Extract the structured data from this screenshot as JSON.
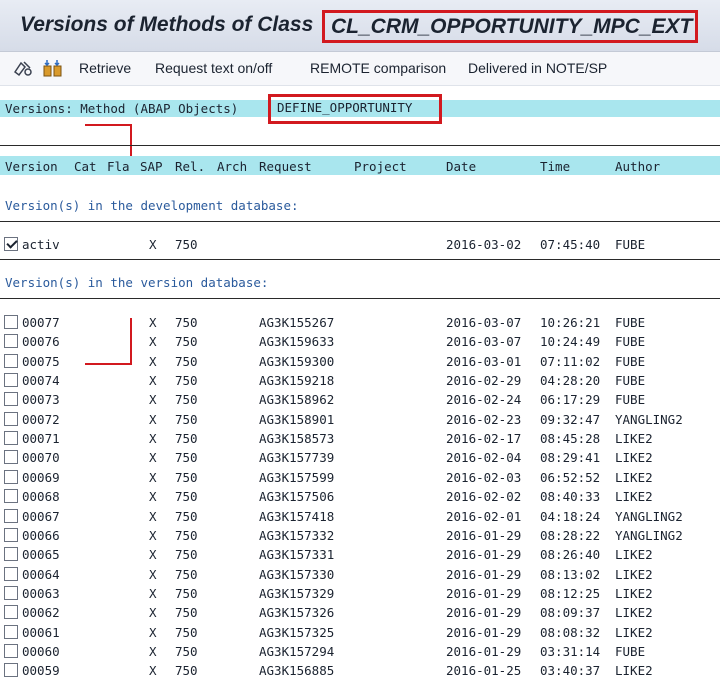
{
  "title": {
    "prefix": "Versions of Methods of Class",
    "class_name": "CL_CRM_OPPORTUNITY_MPC_EXT"
  },
  "toolbar": {
    "icons": [
      "display-change-icon",
      "compare-icon"
    ],
    "retrieve": "Retrieve",
    "request_text": "Request text on/off",
    "remote_comparison": "REMOTE comparison",
    "delivered": "Delivered in NOTE/SP"
  },
  "info": {
    "label": "Versions: Method (ABAP Objects)",
    "method_name": "DEFINE_OPPORTUNITY"
  },
  "columns": [
    "Version",
    "Cat",
    "Fla",
    "SAP",
    "Rel.",
    "Arch",
    "Request",
    "Project",
    "Date",
    "Time",
    "Author"
  ],
  "sections": {
    "development": "Version(s) in the development database:",
    "version_db": "Version(s) in the version database:"
  },
  "active_row": {
    "version": "activ",
    "flag": "X",
    "release": "750",
    "request": "",
    "date": "2016-03-02",
    "time": "07:45:40",
    "author": "FUBE",
    "checked": true
  },
  "rows": [
    {
      "version": "00077",
      "flag": "X",
      "release": "750",
      "request": "AG3K155267",
      "date": "2016-03-07",
      "time": "10:26:21",
      "author": "FUBE"
    },
    {
      "version": "00076",
      "flag": "X",
      "release": "750",
      "request": "AG3K159633",
      "date": "2016-03-07",
      "time": "10:24:49",
      "author": "FUBE"
    },
    {
      "version": "00075",
      "flag": "X",
      "release": "750",
      "request": "AG3K159300",
      "date": "2016-03-01",
      "time": "07:11:02",
      "author": "FUBE"
    },
    {
      "version": "00074",
      "flag": "X",
      "release": "750",
      "request": "AG3K159218",
      "date": "2016-02-29",
      "time": "04:28:20",
      "author": "FUBE"
    },
    {
      "version": "00073",
      "flag": "X",
      "release": "750",
      "request": "AG3K158962",
      "date": "2016-02-24",
      "time": "06:17:29",
      "author": "FUBE"
    },
    {
      "version": "00072",
      "flag": "X",
      "release": "750",
      "request": "AG3K158901",
      "date": "2016-02-23",
      "time": "09:32:47",
      "author": "YANGLING2"
    },
    {
      "version": "00071",
      "flag": "X",
      "release": "750",
      "request": "AG3K158573",
      "date": "2016-02-17",
      "time": "08:45:28",
      "author": "LIKE2"
    },
    {
      "version": "00070",
      "flag": "X",
      "release": "750",
      "request": "AG3K157739",
      "date": "2016-02-04",
      "time": "08:29:41",
      "author": "LIKE2"
    },
    {
      "version": "00069",
      "flag": "X",
      "release": "750",
      "request": "AG3K157599",
      "date": "2016-02-03",
      "time": "06:52:52",
      "author": "LIKE2"
    },
    {
      "version": "00068",
      "flag": "X",
      "release": "750",
      "request": "AG3K157506",
      "date": "2016-02-02",
      "time": "08:40:33",
      "author": "LIKE2"
    },
    {
      "version": "00067",
      "flag": "X",
      "release": "750",
      "request": "AG3K157418",
      "date": "2016-02-01",
      "time": "04:18:24",
      "author": "YANGLING2"
    },
    {
      "version": "00066",
      "flag": "X",
      "release": "750",
      "request": "AG3K157332",
      "date": "2016-01-29",
      "time": "08:28:22",
      "author": "YANGLING2"
    },
    {
      "version": "00065",
      "flag": "X",
      "release": "750",
      "request": "AG3K157331",
      "date": "2016-01-29",
      "time": "08:26:40",
      "author": "LIKE2"
    },
    {
      "version": "00064",
      "flag": "X",
      "release": "750",
      "request": "AG3K157330",
      "date": "2016-01-29",
      "time": "08:13:02",
      "author": "LIKE2"
    },
    {
      "version": "00063",
      "flag": "X",
      "release": "750",
      "request": "AG3K157329",
      "date": "2016-01-29",
      "time": "08:12:25",
      "author": "LIKE2"
    },
    {
      "version": "00062",
      "flag": "X",
      "release": "750",
      "request": "AG3K157326",
      "date": "2016-01-29",
      "time": "08:09:37",
      "author": "LIKE2"
    },
    {
      "version": "00061",
      "flag": "X",
      "release": "750",
      "request": "AG3K157325",
      "date": "2016-01-29",
      "time": "08:08:32",
      "author": "LIKE2"
    },
    {
      "version": "00060",
      "flag": "X",
      "release": "750",
      "request": "AG3K157294",
      "date": "2016-01-29",
      "time": "03:31:14",
      "author": "FUBE"
    },
    {
      "version": "00059",
      "flag": "X",
      "release": "750",
      "request": "AG3K156885",
      "date": "2016-01-25",
      "time": "03:40:37",
      "author": "LIKE2"
    }
  ],
  "colors": {
    "highlight": "#d2191f",
    "header_bg": "#a9e6ee",
    "section_text": "#2a5a9c"
  }
}
